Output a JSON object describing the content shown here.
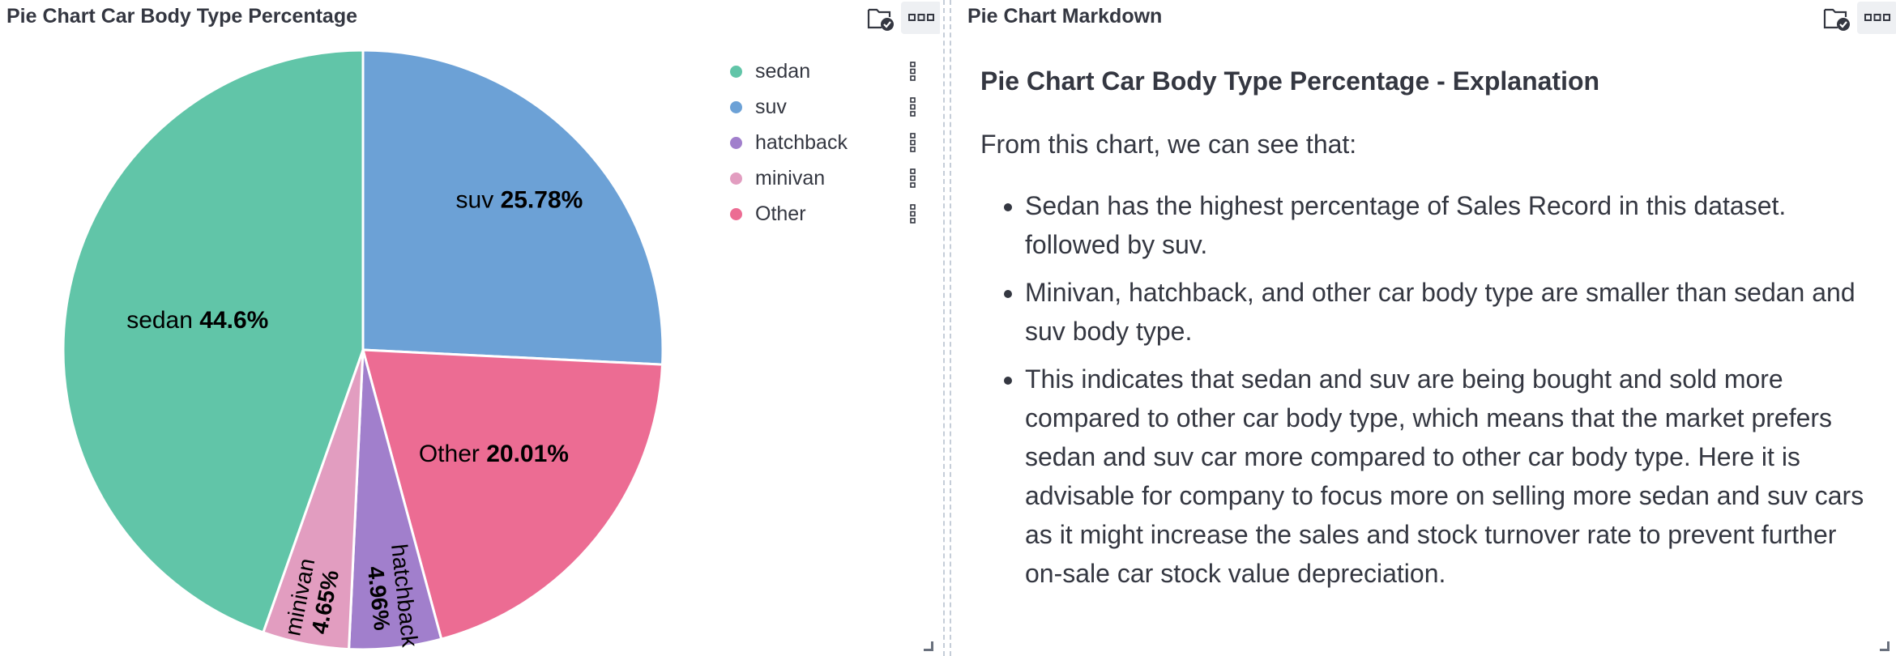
{
  "left_panel": {
    "title": "Pie Chart Car Body Type Percentage"
  },
  "right_panel": {
    "title": "Pie Chart Markdown",
    "markdown": {
      "heading": "Pie Chart Car Body Type Percentage - Explanation",
      "intro": "From this chart, we can see that:",
      "bullets": [
        "Sedan has the highest percentage of Sales Record in this dataset. followed by suv.",
        "Minivan, hatchback, and other car body type are smaller than sedan and suv body type.",
        "This indicates that sedan and suv are being bought and sold more compared to other car body type, which means that the market prefers sedan and suv car more compared to other car body type. Here it is advisable for company to focus more on selling more sedan and suv cars as it might increase the sales and stock turnover rate to prevent further on-sale car stock value depreciation."
      ]
    }
  },
  "icons": {
    "panel_header": "folder-check-icon",
    "panel_options": "more-options-icon",
    "legend_action": "vertical-dots-icon",
    "resize": "resize-corner-icon"
  },
  "chart_data": {
    "type": "pie",
    "slices": [
      {
        "label": "sedan",
        "value": 44.6,
        "value_label": "44.6%",
        "color": "#61c5a8"
      },
      {
        "label": "suv",
        "value": 25.78,
        "value_label": "25.78%",
        "color": "#6ca1d6"
      },
      {
        "label": "Other",
        "value": 20.01,
        "value_label": "20.01%",
        "color": "#ec6c93"
      },
      {
        "label": "hatchback",
        "value": 4.96,
        "value_label": "4.96%",
        "color": "#a17fcc"
      },
      {
        "label": "minivan",
        "value": 4.65,
        "value_label": "4.65%",
        "color": "#e29dc0"
      }
    ],
    "legend": {
      "position": "right",
      "items": [
        {
          "label": "sedan",
          "color": "#61c5a8"
        },
        {
          "label": "suv",
          "color": "#6ca1d6"
        },
        {
          "label": "hatchback",
          "color": "#a17fcc"
        },
        {
          "label": "minivan",
          "color": "#e29dc0"
        },
        {
          "label": "Other",
          "color": "#ec6c93"
        }
      ]
    }
  }
}
